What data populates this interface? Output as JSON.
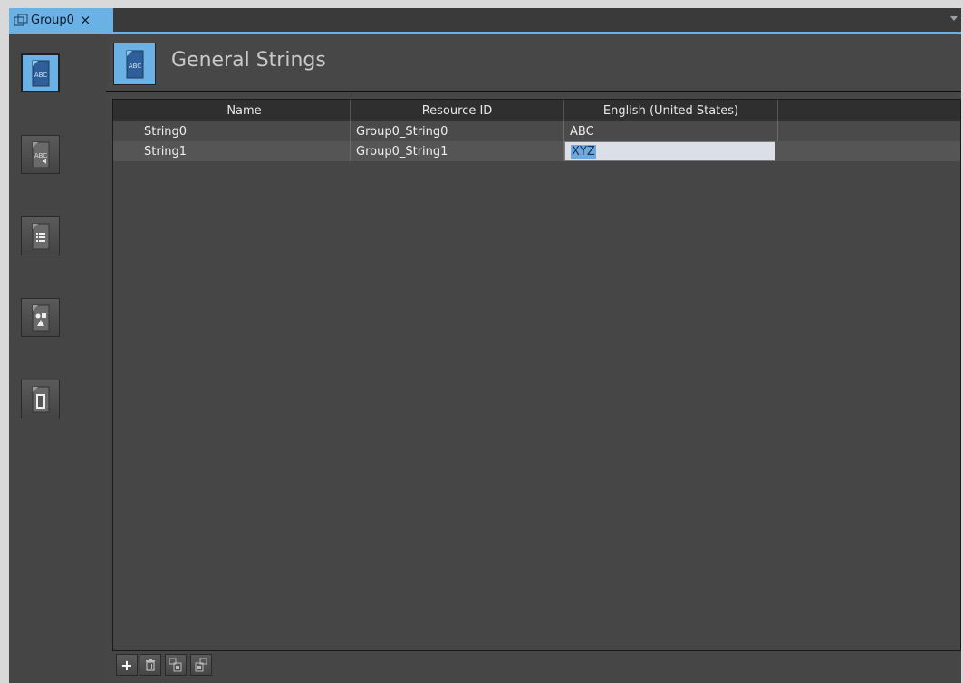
{
  "tab": {
    "label": "Group0",
    "close_glyph": "×"
  },
  "header": {
    "title": "General Strings"
  },
  "rail": {
    "items": [
      {
        "icon": "general-strings-icon",
        "label": "ABC"
      },
      {
        "icon": "voice-strings-icon",
        "label": "ABC"
      },
      {
        "icon": "list-icon"
      },
      {
        "icon": "image-icon"
      },
      {
        "icon": "media-icon"
      }
    ]
  },
  "grid": {
    "columns": [
      "Name",
      "Resource ID",
      "English (United States)"
    ],
    "rows": [
      {
        "name": "String0",
        "resource_id": "Group0_String0",
        "english": "ABC"
      },
      {
        "name": "String1",
        "resource_id": "Group0_String1",
        "english": "XYZ"
      }
    ]
  },
  "toolbar": {
    "buttons": [
      "add-icon",
      "delete-icon",
      "import-icon",
      "export-icon"
    ],
    "add_glyph": "+"
  },
  "colors": {
    "accent": "#6ab1e6",
    "panel": "#464646"
  }
}
